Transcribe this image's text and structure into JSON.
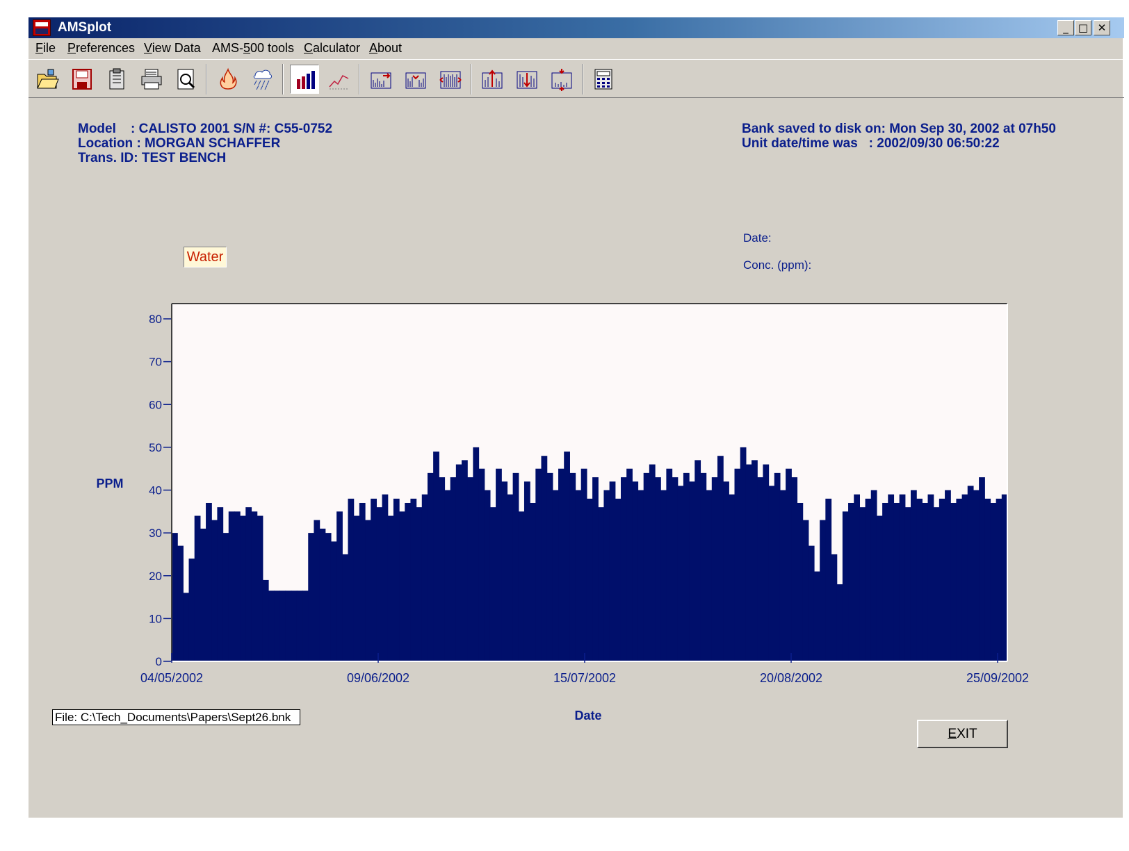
{
  "window": {
    "title": "AMSplot"
  },
  "menu": [
    {
      "pre": "",
      "ul": "F",
      "post": "ile"
    },
    {
      "pre": "",
      "ul": "P",
      "post": "references"
    },
    {
      "pre": "",
      "ul": "V",
      "post": "iew Data"
    },
    {
      "pre": "AMS-",
      "ul": "5",
      "post": "00 tools"
    },
    {
      "pre": "",
      "ul": "C",
      "post": "alculator"
    },
    {
      "pre": "",
      "ul": "A",
      "post": "bout"
    }
  ],
  "toolbar": {
    "icons": [
      "open-folder-icon",
      "save-floppy-icon",
      "clipboard-icon",
      "printer-icon",
      "print-preview-icon",
      "fire-icon",
      "rain-icon",
      "bar-chart-icon",
      "line-chart-icon",
      "scroll-right-icon",
      "zoom-in-horizontal-icon",
      "zoom-out-horizontal-icon",
      "scale-up-icon",
      "scale-down-icon",
      "fit-vertical-icon",
      "calculator-icon"
    ],
    "pressed": [
      "bar-chart-icon"
    ]
  },
  "info": {
    "model_line": "Model    : CALISTO 2001 S/N #: C55-0752",
    "location_line": "Location : MORGAN SCHAFFER",
    "trans_line": "Trans. ID: TEST BENCH",
    "saved_line": "Bank saved to disk on: Mon Sep 30, 2002 at 07h50",
    "unit_line": "Unit date/time was   : 2002/09/30 06:50:22"
  },
  "cursor": {
    "date_label": "Date:",
    "conc_label": "Conc. (ppm):"
  },
  "legend": {
    "label": "Water"
  },
  "file_path": "File: C:\\Tech_Documents\\Papers\\Sept26.bnk",
  "exit_label": {
    "ul": "E",
    "rest": "XIT"
  },
  "colors": {
    "bar": "#000f6b",
    "plot_bg": "#fdf9f9",
    "axis_text": "#0a1e8c",
    "window_bg": "#d4d0c8"
  },
  "chart_data": {
    "type": "bar",
    "xlabel": "Date",
    "ylabel": "PPM",
    "ylim": [
      0,
      80
    ],
    "yticks": [
      0,
      10,
      20,
      30,
      40,
      50,
      60,
      70,
      80
    ],
    "xtick_labels": [
      "04/05/2002",
      "09/06/2002",
      "15/07/2002",
      "20/08/2002",
      "25/09/2002"
    ],
    "xlim": [
      "2002-05-04",
      "2002-09-28"
    ],
    "series": [
      {
        "points": [
          [
            "2002-05-04",
            30
          ],
          [
            "2002-05-05",
            27
          ],
          [
            "2002-05-06",
            16
          ],
          [
            "2002-05-07",
            24
          ],
          [
            "2002-05-08",
            34
          ],
          [
            "2002-05-09",
            31
          ],
          [
            "2002-05-10",
            37
          ],
          [
            "2002-05-11",
            33
          ],
          [
            "2002-05-12",
            36
          ],
          [
            "2002-05-13",
            30
          ],
          [
            "2002-05-14",
            35
          ],
          [
            "2002-05-15",
            35
          ],
          [
            "2002-05-16",
            34
          ],
          [
            "2002-05-17",
            36
          ],
          [
            "2002-05-18",
            35
          ],
          [
            "2002-05-19",
            34
          ],
          [
            "2002-05-20",
            19
          ],
          [
            "2002-05-21",
            16.5
          ],
          [
            "2002-05-22",
            16.5
          ],
          [
            "2002-05-23",
            16.5
          ],
          [
            "2002-05-24",
            16.5
          ],
          [
            "2002-05-25",
            16.5
          ],
          [
            "2002-05-26",
            16.5
          ],
          [
            "2002-05-27",
            16.5
          ],
          [
            "2002-05-28",
            30
          ],
          [
            "2002-05-29",
            33
          ],
          [
            "2002-05-30",
            31
          ],
          [
            "2002-05-31",
            30
          ],
          [
            "2002-06-01",
            28
          ],
          [
            "2002-06-02",
            35
          ],
          [
            "2002-06-03",
            25
          ],
          [
            "2002-06-04",
            38
          ],
          [
            "2002-06-05",
            34
          ],
          [
            "2002-06-06",
            37
          ],
          [
            "2002-06-07",
            33
          ],
          [
            "2002-06-08",
            38
          ],
          [
            "2002-06-09",
            36
          ],
          [
            "2002-06-10",
            39
          ],
          [
            "2002-06-11",
            34
          ],
          [
            "2002-06-12",
            38
          ],
          [
            "2002-06-13",
            35
          ],
          [
            "2002-06-14",
            37
          ],
          [
            "2002-06-15",
            38
          ],
          [
            "2002-06-16",
            36
          ],
          [
            "2002-06-17",
            39
          ],
          [
            "2002-06-18",
            44
          ],
          [
            "2002-06-19",
            49
          ],
          [
            "2002-06-20",
            43
          ],
          [
            "2002-06-21",
            40
          ],
          [
            "2002-06-22",
            43
          ],
          [
            "2002-06-23",
            46
          ],
          [
            "2002-06-24",
            47
          ],
          [
            "2002-06-25",
            43
          ],
          [
            "2002-06-26",
            50
          ],
          [
            "2002-06-27",
            45
          ],
          [
            "2002-06-28",
            40
          ],
          [
            "2002-06-29",
            36
          ],
          [
            "2002-06-30",
            45
          ],
          [
            "2002-07-01",
            42
          ],
          [
            "2002-07-02",
            39
          ],
          [
            "2002-07-03",
            44
          ],
          [
            "2002-07-04",
            35
          ],
          [
            "2002-07-05",
            42
          ],
          [
            "2002-07-06",
            37
          ],
          [
            "2002-07-07",
            45
          ],
          [
            "2002-07-08",
            48
          ],
          [
            "2002-07-09",
            44
          ],
          [
            "2002-07-10",
            40
          ],
          [
            "2002-07-11",
            45
          ],
          [
            "2002-07-12",
            49
          ],
          [
            "2002-07-13",
            44
          ],
          [
            "2002-07-14",
            40
          ],
          [
            "2002-07-15",
            45
          ],
          [
            "2002-07-16",
            38
          ],
          [
            "2002-07-17",
            43
          ],
          [
            "2002-07-18",
            36
          ],
          [
            "2002-07-19",
            40
          ],
          [
            "2002-07-20",
            42
          ],
          [
            "2002-07-21",
            38
          ],
          [
            "2002-07-22",
            43
          ],
          [
            "2002-07-23",
            45
          ],
          [
            "2002-07-24",
            42
          ],
          [
            "2002-07-25",
            40
          ],
          [
            "2002-07-26",
            44
          ],
          [
            "2002-07-27",
            46
          ],
          [
            "2002-07-28",
            43
          ],
          [
            "2002-07-29",
            40
          ],
          [
            "2002-07-30",
            45
          ],
          [
            "2002-07-31",
            43
          ],
          [
            "2002-08-01",
            41
          ],
          [
            "2002-08-02",
            44
          ],
          [
            "2002-08-03",
            42
          ],
          [
            "2002-08-04",
            47
          ],
          [
            "2002-08-05",
            44
          ],
          [
            "2002-08-06",
            40
          ],
          [
            "2002-08-07",
            43
          ],
          [
            "2002-08-08",
            48
          ],
          [
            "2002-08-09",
            42
          ],
          [
            "2002-08-10",
            39
          ],
          [
            "2002-08-11",
            45
          ],
          [
            "2002-08-12",
            50
          ],
          [
            "2002-08-13",
            46
          ],
          [
            "2002-08-14",
            47
          ],
          [
            "2002-08-15",
            43
          ],
          [
            "2002-08-16",
            46
          ],
          [
            "2002-08-17",
            41
          ],
          [
            "2002-08-18",
            44
          ],
          [
            "2002-08-19",
            40
          ],
          [
            "2002-08-20",
            45
          ],
          [
            "2002-08-21",
            43
          ],
          [
            "2002-08-22",
            37
          ],
          [
            "2002-08-23",
            33
          ],
          [
            "2002-08-24",
            27
          ],
          [
            "2002-08-25",
            21
          ],
          [
            "2002-08-26",
            33
          ],
          [
            "2002-08-27",
            38
          ],
          [
            "2002-08-28",
            25
          ],
          [
            "2002-08-29",
            18
          ],
          [
            "2002-08-30",
            35
          ],
          [
            "2002-08-31",
            37
          ],
          [
            "2002-09-01",
            39
          ],
          [
            "2002-09-02",
            36
          ],
          [
            "2002-09-03",
            38
          ],
          [
            "2002-09-04",
            40
          ],
          [
            "2002-09-05",
            34
          ],
          [
            "2002-09-06",
            37
          ],
          [
            "2002-09-07",
            39
          ],
          [
            "2002-09-08",
            37
          ],
          [
            "2002-09-09",
            39
          ],
          [
            "2002-09-10",
            36
          ],
          [
            "2002-09-11",
            40
          ],
          [
            "2002-09-12",
            38
          ],
          [
            "2002-09-13",
            37
          ],
          [
            "2002-09-14",
            39
          ],
          [
            "2002-09-15",
            36
          ],
          [
            "2002-09-16",
            38
          ],
          [
            "2002-09-17",
            40
          ],
          [
            "2002-09-18",
            37
          ],
          [
            "2002-09-19",
            38
          ],
          [
            "2002-09-20",
            39
          ],
          [
            "2002-09-21",
            41
          ],
          [
            "2002-09-22",
            40
          ],
          [
            "2002-09-23",
            43
          ],
          [
            "2002-09-24",
            38
          ],
          [
            "2002-09-25",
            37
          ],
          [
            "2002-09-26",
            38
          ],
          [
            "2002-09-27",
            39
          ]
        ]
      }
    ]
  }
}
